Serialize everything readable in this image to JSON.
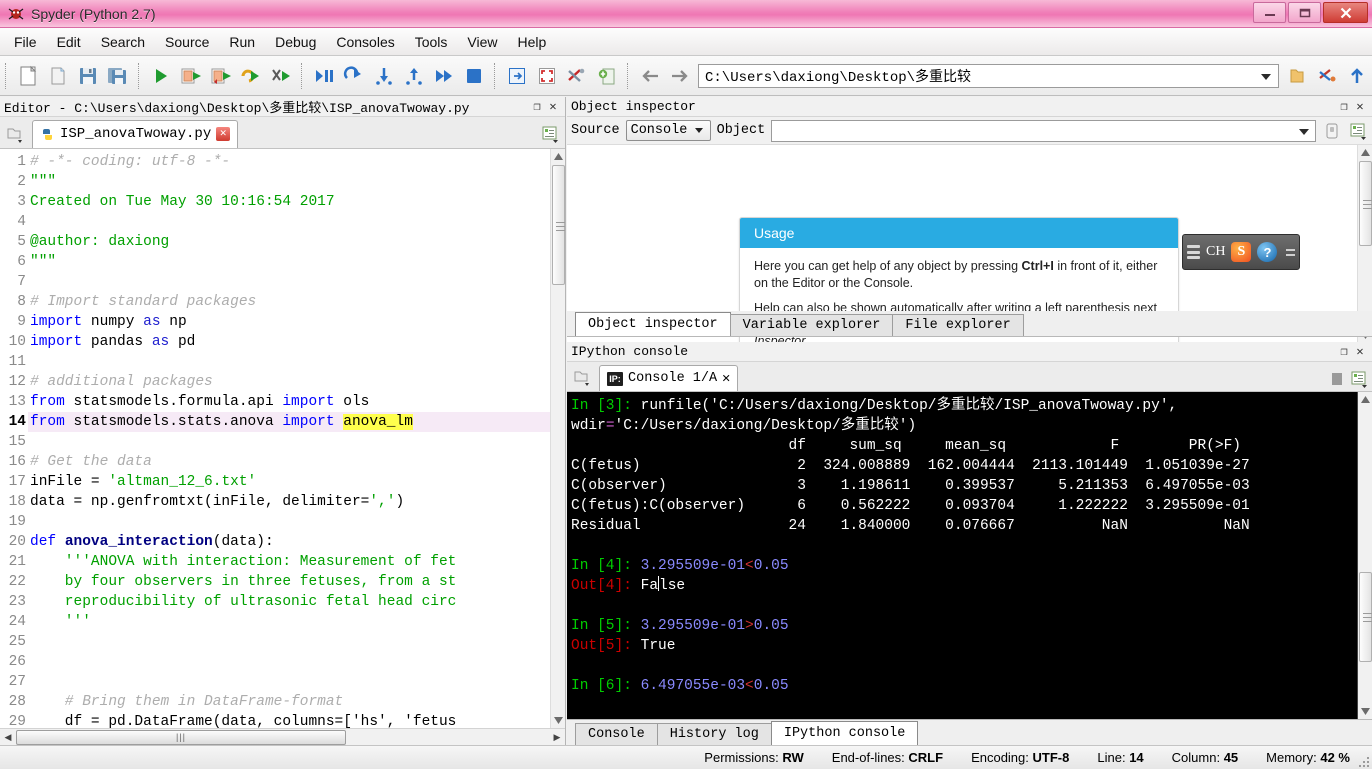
{
  "window": {
    "title": "Spyder (Python 2.7)",
    "icon": "spyder-logo-icon",
    "minimize_label": "–",
    "maximize_label": "❑",
    "close_label": "✕"
  },
  "menubar": {
    "items": [
      {
        "label": "File"
      },
      {
        "label": "Edit"
      },
      {
        "label": "Search"
      },
      {
        "label": "Source"
      },
      {
        "label": "Run"
      },
      {
        "label": "Debug"
      },
      {
        "label": "Consoles"
      },
      {
        "label": "Tools"
      },
      {
        "label": "View"
      },
      {
        "label": "Help"
      }
    ]
  },
  "toolbar": {
    "path_value": "C:\\Users\\daxiong\\Desktop\\多重比较",
    "buttons": [
      "new-file-icon",
      "open-file-icon",
      "save-file-icon",
      "save-all-icon",
      "run-file-icon",
      "run-cell-icon",
      "run-cell-advance-icon",
      "run-selection-icon",
      "configure-run-icon",
      "debug-file-icon",
      "debug-continue-icon",
      "debug-step-into-icon",
      "debug-step-return-icon",
      "debug-step-over-icon",
      "debug-stop-icon",
      "maximize-pane-icon",
      "fullscreen-icon",
      "preferences-icon",
      "pythonpath-manager-icon",
      "back-icon",
      "forward-icon",
      "browse-folder-icon",
      "python-path-icon",
      "parent-directory-icon"
    ]
  },
  "editor": {
    "panel_title": "Editor - C:\\Users\\daxiong\\Desktop\\多重比较\\ISP_anovaTwoway.py",
    "undock_label": "❐",
    "close_label": "✕",
    "tab": {
      "label": "ISP_anovaTwoway.py",
      "close_label": "✕"
    },
    "current_line": 14,
    "lines": [
      {
        "n": 1,
        "tokens": [
          {
            "t": "# -*- coding: utf-8 -*-",
            "c": "c-com"
          }
        ]
      },
      {
        "n": 2,
        "tokens": [
          {
            "t": "\"\"\"",
            "c": "c-str"
          }
        ]
      },
      {
        "n": 3,
        "tokens": [
          {
            "t": "Created on Tue May 30 10:16:54 2017",
            "c": "c-str"
          }
        ]
      },
      {
        "n": 4,
        "tokens": []
      },
      {
        "n": 5,
        "tokens": [
          {
            "t": "@author: daxiong",
            "c": "c-str"
          }
        ]
      },
      {
        "n": 6,
        "tokens": [
          {
            "t": "\"\"\"",
            "c": "c-str"
          }
        ]
      },
      {
        "n": 7,
        "tokens": []
      },
      {
        "n": 8,
        "tokens": [
          {
            "t": "# Import standard packages",
            "c": "c-com"
          }
        ]
      },
      {
        "n": 9,
        "tokens": [
          {
            "t": "import ",
            "c": "c-kw"
          },
          {
            "t": "numpy ",
            "c": "c-txt"
          },
          {
            "t": "as ",
            "c": "c-kw2"
          },
          {
            "t": "np",
            "c": "c-txt"
          }
        ]
      },
      {
        "n": 10,
        "tokens": [
          {
            "t": "import ",
            "c": "c-kw"
          },
          {
            "t": "pandas ",
            "c": "c-txt"
          },
          {
            "t": "as ",
            "c": "c-kw2"
          },
          {
            "t": "pd",
            "c": "c-txt"
          }
        ]
      },
      {
        "n": 11,
        "tokens": []
      },
      {
        "n": 12,
        "tokens": [
          {
            "t": "# additional packages",
            "c": "c-com"
          }
        ]
      },
      {
        "n": 13,
        "tokens": [
          {
            "t": "from ",
            "c": "c-kw"
          },
          {
            "t": "statsmodels.formula.api ",
            "c": "c-txt"
          },
          {
            "t": "import ",
            "c": "c-kw"
          },
          {
            "t": "ols",
            "c": "c-txt"
          }
        ]
      },
      {
        "n": 14,
        "hl": true,
        "tokens": [
          {
            "t": "from ",
            "c": "c-kw"
          },
          {
            "t": "statsmodels.stats.anova ",
            "c": "c-txt"
          },
          {
            "t": "import ",
            "c": "c-kw"
          },
          {
            "t": "anova_lm",
            "c": "c-hit"
          }
        ]
      },
      {
        "n": 15,
        "tokens": []
      },
      {
        "n": 16,
        "tokens": [
          {
            "t": "# Get the data",
            "c": "c-com"
          }
        ]
      },
      {
        "n": 17,
        "tokens": [
          {
            "t": "inFile = ",
            "c": "c-txt"
          },
          {
            "t": "'altman_12_6.txt'",
            "c": "c-str"
          }
        ]
      },
      {
        "n": 18,
        "tokens": [
          {
            "t": "data = np.genfromtxt(inFile, delimiter=",
            "c": "c-txt"
          },
          {
            "t": "','",
            "c": "c-str"
          },
          {
            "t": ")",
            "c": "c-txt"
          }
        ]
      },
      {
        "n": 19,
        "tokens": []
      },
      {
        "n": 20,
        "tokens": [
          {
            "t": "def ",
            "c": "c-def"
          },
          {
            "t": "anova_interaction",
            "c": "c-fn"
          },
          {
            "t": "(data):",
            "c": "c-txt"
          }
        ]
      },
      {
        "n": 21,
        "tokens": [
          {
            "t": "    '''ANOVA with interaction: Measurement of fet",
            "c": "c-str"
          }
        ]
      },
      {
        "n": 22,
        "tokens": [
          {
            "t": "    by four observers in three fetuses, from a st",
            "c": "c-str"
          }
        ]
      },
      {
        "n": 23,
        "tokens": [
          {
            "t": "    reproducibility of ultrasonic fetal head circ",
            "c": "c-str"
          }
        ]
      },
      {
        "n": 24,
        "tokens": [
          {
            "t": "    '''",
            "c": "c-str"
          }
        ]
      },
      {
        "n": 25,
        "tokens": []
      },
      {
        "n": 26,
        "tokens": []
      },
      {
        "n": 27,
        "tokens": []
      },
      {
        "n": 28,
        "tokens": [
          {
            "t": "    # Bring them in DataFrame-format",
            "c": "c-com"
          }
        ]
      },
      {
        "n": 29,
        "tokens": [
          {
            "t": "    df = pd.DataFrame(data, columns=['hs', 'fetus",
            "c": "c-txt"
          }
        ]
      }
    ]
  },
  "object_inspector": {
    "panel_title": "Object inspector",
    "undock_label": "❐",
    "close_label": "✕",
    "source_label": "Source",
    "source_value": "Console",
    "object_label": "Object",
    "object_value": "",
    "lock_icon": "lock-icon",
    "options_icon": "options-menu-icon",
    "usage": {
      "heading": "Usage",
      "p1_a": "Here you can get help of any object by pressing ",
      "p1_b": "Ctrl+I",
      "p1_c": " in front of it, either on the Editor or the Console.",
      "p2_a": "Help can also be shown automatically after writing a left parenthesis next to an object. You can activate this behavior in ",
      "p2_b": "Preferences > Object Inspector."
    },
    "tabs": [
      {
        "label": "Object inspector",
        "active": true
      },
      {
        "label": "Variable explorer",
        "active": false
      },
      {
        "label": "File explorer",
        "active": false
      }
    ]
  },
  "ime_bar": {
    "grip_icon": "drag-grip-icon",
    "language": "CH",
    "sogou_icon": "sogou-pinyin-icon",
    "help_icon": "ime-help-icon",
    "expand_icon": "ime-expand-icon"
  },
  "ipython_console": {
    "panel_title": "IPython console",
    "undock_label": "❐",
    "close_label": "✕",
    "tab": {
      "icon_label": "IP:",
      "label": "Console 1/A",
      "close_label": "✕"
    },
    "stop_icon": "interrupt-kernel-icon",
    "options_icon": "console-options-icon",
    "lines": [
      [
        {
          "t": "In ",
          "c": "g"
        },
        {
          "t": "[3]",
          "c": "g"
        },
        {
          "t": ": ",
          "c": "g"
        },
        {
          "t": "runfile(",
          "c": "w"
        },
        {
          "t": "'C:/Users/daxiong/Desktop/多重比较/ISP_anovaTwoway.py'",
          "c": "w"
        },
        {
          "t": ",",
          "c": "w"
        }
      ],
      [
        {
          "t": "wdir",
          "c": "w"
        },
        {
          "t": "=",
          "c": "m"
        },
        {
          "t": "'C:/Users/daxiong/Desktop/多重比较'",
          "c": "w"
        },
        {
          "t": ")",
          "c": "w"
        }
      ],
      [
        {
          "t": "                         df     sum_sq     mean_sq            F        PR(>F)",
          "c": "w"
        }
      ],
      [
        {
          "t": "C(fetus)                  2  324.008889  162.004444  2113.101449  1.051039e-27",
          "c": "w"
        }
      ],
      [
        {
          "t": "C(observer)               3    1.198611    0.399537     5.211353  6.497055e-03",
          "c": "w"
        }
      ],
      [
        {
          "t": "C(fetus):C(observer)      6    0.562222    0.093704     1.222222  3.295509e-01",
          "c": "w"
        }
      ],
      [
        {
          "t": "Residual                 24    1.840000    0.076667          NaN           NaN",
          "c": "w"
        }
      ],
      [],
      [
        {
          "t": "In ",
          "c": "g"
        },
        {
          "t": "[4]",
          "c": "g"
        },
        {
          "t": ": ",
          "c": "g"
        },
        {
          "t": "3.295509e-01",
          "c": "b"
        },
        {
          "t": "<",
          "c": "redop"
        },
        {
          "t": "0.05",
          "c": "b"
        }
      ],
      [
        {
          "t": "Out",
          "c": "r"
        },
        {
          "t": "[4]",
          "c": "r"
        },
        {
          "t": ": ",
          "c": "r"
        },
        {
          "t": "False",
          "c": "w",
          "cursor_after": 2
        }
      ],
      [],
      [
        {
          "t": "In ",
          "c": "g"
        },
        {
          "t": "[5]",
          "c": "g"
        },
        {
          "t": ": ",
          "c": "g"
        },
        {
          "t": "3.295509e-01",
          "c": "b"
        },
        {
          "t": ">",
          "c": "redop"
        },
        {
          "t": "0.05",
          "c": "b"
        }
      ],
      [
        {
          "t": "Out",
          "c": "r"
        },
        {
          "t": "[5]",
          "c": "r"
        },
        {
          "t": ": ",
          "c": "r"
        },
        {
          "t": "True",
          "c": "w"
        }
      ],
      [],
      [
        {
          "t": "In ",
          "c": "g"
        },
        {
          "t": "[6]",
          "c": "g"
        },
        {
          "t": ": ",
          "c": "g"
        },
        {
          "t": "6.497055e-03",
          "c": "b"
        },
        {
          "t": "<",
          "c": "redop"
        },
        {
          "t": "0.05",
          "c": "b"
        }
      ]
    ],
    "bottom_tabs": [
      {
        "label": "Console",
        "active": false
      },
      {
        "label": "History log",
        "active": false
      },
      {
        "label": "IPython console",
        "active": true
      }
    ]
  },
  "statusbar": {
    "items": [
      {
        "label": "Permissions:",
        "value": "RW"
      },
      {
        "label": "End-of-lines:",
        "value": "CRLF"
      },
      {
        "label": "Encoding:",
        "value": "UTF-8"
      },
      {
        "label": "Line:",
        "value": "14"
      },
      {
        "label": "Column:",
        "value": "45"
      },
      {
        "label": "Memory:",
        "value": "42 %"
      }
    ]
  },
  "colors": {
    "title_pink": "#f07fb8",
    "accent_blue": "#29abe2",
    "console_bg": "#000000",
    "highlight_yellow": "#ffff4d",
    "current_line": "#f6eaf6"
  }
}
